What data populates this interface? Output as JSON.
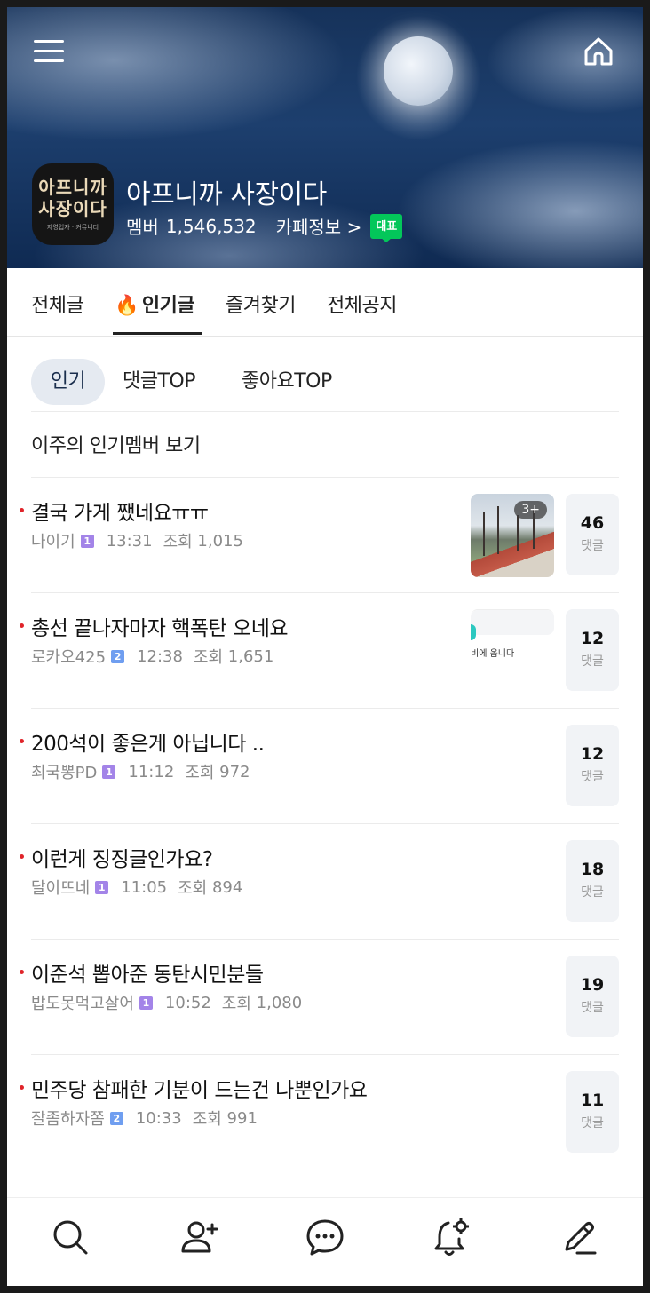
{
  "header": {
    "cafe_name": "아프니까 사장이다",
    "member_label": "멤버",
    "member_count": "1,546,532",
    "cafe_info_label": "카페정보 >",
    "rep_badge": "대표",
    "logo_line1": "아프니까",
    "logo_line2": "사장이다",
    "logo_small": "자영업자 · 커뮤니티"
  },
  "tabs": [
    {
      "label": "전체글",
      "active": false
    },
    {
      "label": "인기글",
      "active": true,
      "icon": "fire-icon"
    },
    {
      "label": "즐겨찾기",
      "active": false
    },
    {
      "label": "전체공지",
      "active": false
    }
  ],
  "filters": [
    {
      "label": "인기",
      "active": true
    },
    {
      "label": "댓글TOP",
      "active": false
    },
    {
      "label": "좋아요TOP",
      "active": false
    }
  ],
  "weekly_members_link": "이주의 인기멤버 보기",
  "comment_label": "댓글",
  "view_label": "조회",
  "posts": [
    {
      "title": "결국 가게 쨌네요ㅠㅠ",
      "author": "나이기",
      "level": "1",
      "time": "13:31",
      "views": "1,015",
      "comments": "46",
      "thumb": "photo",
      "photo_count": "3+"
    },
    {
      "title": "총선 끝나자마자 핵폭탄 오네요",
      "author": "로카오425",
      "level": "2",
      "time": "12:38",
      "views": "1,651",
      "comments": "12",
      "thumb": "screenshot",
      "thumb_text": "비에 옵니다"
    },
    {
      "title": "200석이 좋은게 아닙니다 ..",
      "author": "최국뽕PD",
      "level": "1",
      "time": "11:12",
      "views": "972",
      "comments": "12"
    },
    {
      "title": "이런게 징징글인가요?",
      "author": "달이뜨네",
      "level": "1",
      "time": "11:05",
      "views": "894",
      "comments": "18"
    },
    {
      "title": "이준석 뽑아준 동탄시민분들",
      "author": "밥도못먹고살어",
      "level": "1",
      "time": "10:52",
      "views": "1,080",
      "comments": "19"
    },
    {
      "title": "민주당 참패한 기분이 드는건 나뿐인가요",
      "author": "잘좀하자쫌",
      "level": "2",
      "time": "10:33",
      "views": "991",
      "comments": "11"
    }
  ],
  "bottom_nav": [
    {
      "name": "search",
      "icon": "search-icon"
    },
    {
      "name": "invite-member",
      "icon": "add-user-icon"
    },
    {
      "name": "chat",
      "icon": "chat-icon"
    },
    {
      "name": "notification-settings",
      "icon": "bell-gear-icon"
    },
    {
      "name": "write",
      "icon": "pencil-icon"
    }
  ]
}
